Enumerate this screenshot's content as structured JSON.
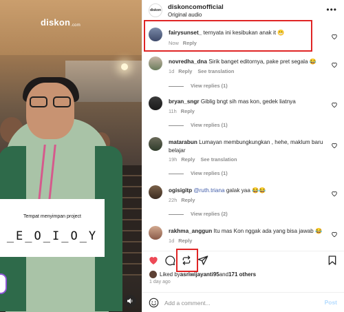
{
  "video": {
    "brand_logo_text": "diskon",
    "brand_logo_suffix": ".com",
    "caption_small": "Tempat menyimpan project",
    "caption_big": "_E_O_I_O_Y"
  },
  "post": {
    "username": "diskoncomofficial",
    "audio_label": "Original audio",
    "avatar_text": "diskon"
  },
  "comments": [
    {
      "user": "fairysunset_",
      "text": "ternyata ini kesibukan anak it 😬",
      "time": "Now",
      "actions": [
        "Reply"
      ]
    },
    {
      "user": "novredha_dna",
      "text": "Sirik banget editornya, pake pret segala 😂",
      "time": "1d",
      "actions": [
        "Reply",
        "See translation"
      ],
      "replies": "View replies (1)"
    },
    {
      "user": "bryan_sngr",
      "text": "Giblig bngt sih mas kon, gedek liatnya",
      "time": "11h",
      "actions": [
        "Reply"
      ],
      "replies": "View replies (1)"
    },
    {
      "user": "matarabun",
      "text": "Lumayan membungkungkan , hehe, maklum baru belajar",
      "time": "19h",
      "actions": [
        "Reply",
        "See translation"
      ],
      "replies": "View replies (1)"
    },
    {
      "user": "ogisigitp",
      "mention": "@ruth.triana",
      "text": " galak yaa 😂😂",
      "time": "22h",
      "actions": [
        "Reply"
      ],
      "replies": "View replies (2)"
    },
    {
      "user": "rakhma_anggun",
      "text": "Itu mas Kon nggak ada yang bisa jawab 😂",
      "time": "1d",
      "actions": [
        "Reply"
      ]
    }
  ],
  "liked_by": {
    "prefix": "Liked by ",
    "user": "asriwijayanti95",
    "middle": " and ",
    "others": "171 others"
  },
  "time_ago": "1 day ago",
  "add_comment": {
    "placeholder": "Add a comment...",
    "post_label": "Post"
  },
  "colors": {
    "like_red": "#ed4956",
    "highlight_red": "#e02424",
    "post_button": "#b3dbff",
    "mention": "#3e5aa8"
  },
  "icons": [
    "more-icon",
    "heart-icon",
    "comment-icon",
    "repost-icon",
    "share-icon",
    "save-icon",
    "emoji-icon",
    "audio-icon"
  ]
}
